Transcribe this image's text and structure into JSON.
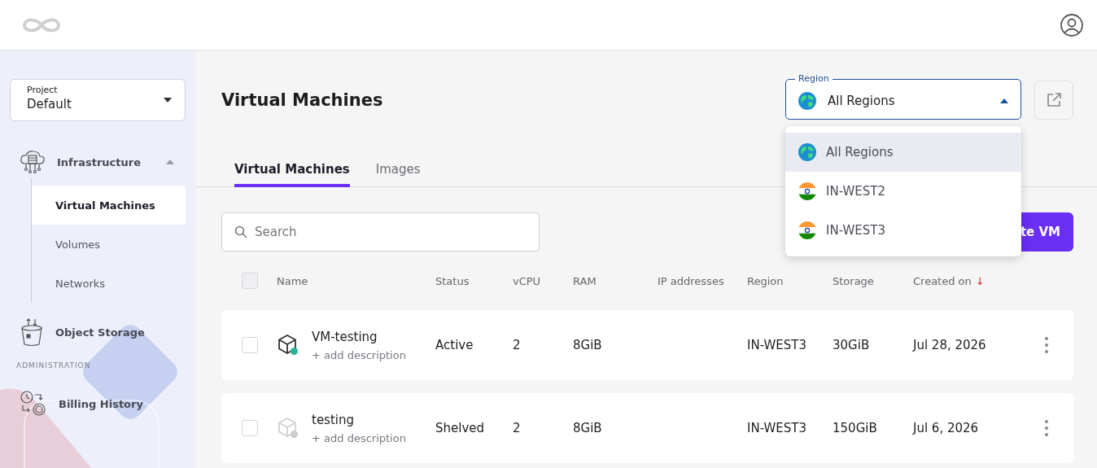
{
  "sidebar": {
    "project": {
      "label": "Project",
      "value": "Default"
    },
    "sections": [
      {
        "label": "Infrastructure",
        "expanded": true,
        "children": [
          {
            "label": "Virtual Machines",
            "selected": true
          },
          {
            "label": "Volumes",
            "selected": false
          },
          {
            "label": "Networks",
            "selected": false
          }
        ]
      },
      {
        "label": "Object Storage"
      }
    ],
    "admin_heading": "ADMINISTRATION",
    "admin_items": [
      {
        "label": "Billing History"
      }
    ]
  },
  "page": {
    "title": "Virtual Machines"
  },
  "region_select": {
    "label": "Region",
    "value": "All Regions",
    "expanded": true,
    "options": [
      {
        "label": "All Regions",
        "kind": "globe",
        "selected": true
      },
      {
        "label": "IN-WEST2",
        "kind": "flag",
        "selected": false
      },
      {
        "label": "IN-WEST3",
        "kind": "flag",
        "selected": false
      }
    ]
  },
  "tabs": [
    {
      "label": "Virtual Machines",
      "selected": true
    },
    {
      "label": "Images",
      "selected": false
    }
  ],
  "search": {
    "placeholder": "Search"
  },
  "create_button": "te VM",
  "table": {
    "all_checked": false,
    "columns": [
      "Name",
      "Status",
      "vCPU",
      "RAM",
      "IP addresses",
      "Region",
      "Storage",
      "Created on"
    ],
    "sort_arrow": "↓",
    "rows": [
      {
        "checked": false,
        "name": "VM-testing",
        "description": "+ add description",
        "status": "Active",
        "active": true,
        "color": "#2bb39a",
        "vcpu": "2",
        "ram": "8GiB",
        "region": "IN-WEST3",
        "storage": "30GiB",
        "created": "Jul 28, 2026"
      },
      {
        "checked": false,
        "name": "testing",
        "description": "+ add description",
        "status": "Shelved",
        "active": false,
        "color": "#cccccc",
        "vcpu": "2",
        "ram": "8GiB",
        "region": "IN-WEST3",
        "storage": "150GiB",
        "created": "Jul 6, 2026"
      }
    ]
  }
}
